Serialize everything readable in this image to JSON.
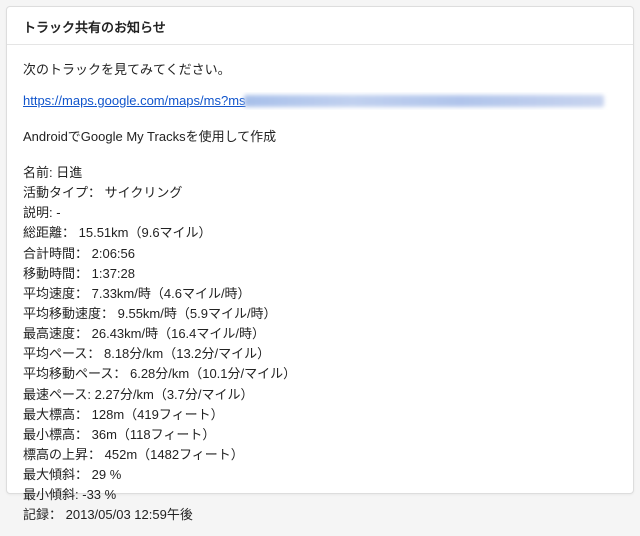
{
  "header": {
    "title": "トラック共有のお知らせ"
  },
  "body": {
    "intro": "次のトラックを見てみてください。",
    "link_visible": "https://maps.google.com/maps/ms?ms",
    "created_by": "AndroidでGoogle My Tracksを使用して作成"
  },
  "stats": [
    {
      "label": "名前:",
      "value": "日進"
    },
    {
      "label": "活動タイプ：",
      "value": "サイクリング"
    },
    {
      "label": "説明:",
      "value": "-"
    },
    {
      "label": "総距離：",
      "value": "15.51km（9.6マイル）"
    },
    {
      "label": "合計時間：",
      "value": "2:06:56"
    },
    {
      "label": "移動時間：",
      "value": "1:37:28"
    },
    {
      "label": "平均速度：",
      "value": "7.33km/時（4.6マイル/時）"
    },
    {
      "label": "平均移動速度：",
      "value": "9.55km/時（5.9マイル/時）"
    },
    {
      "label": "最高速度：",
      "value": "26.43km/時（16.4マイル/時）"
    },
    {
      "label": "平均ペース：",
      "value": "8.18分/km（13.2分/マイル）"
    },
    {
      "label": "平均移動ペース：",
      "value": "6.28分/km（10.1分/マイル）"
    },
    {
      "label": "最速ペース:",
      "value": "2.27分/km（3.7分/マイル）"
    },
    {
      "label": "最大標高：",
      "value": "128m（419フィート）"
    },
    {
      "label": "最小標高：",
      "value": "36m（118フィート）"
    },
    {
      "label": "標高の上昇：",
      "value": "452m（1482フィート）"
    },
    {
      "label": "最大傾斜：",
      "value": "29 %"
    },
    {
      "label": "最小傾斜:",
      "value": "-33 %"
    },
    {
      "label": "記録：",
      "value": "2013/05/03 12:59午後"
    }
  ]
}
